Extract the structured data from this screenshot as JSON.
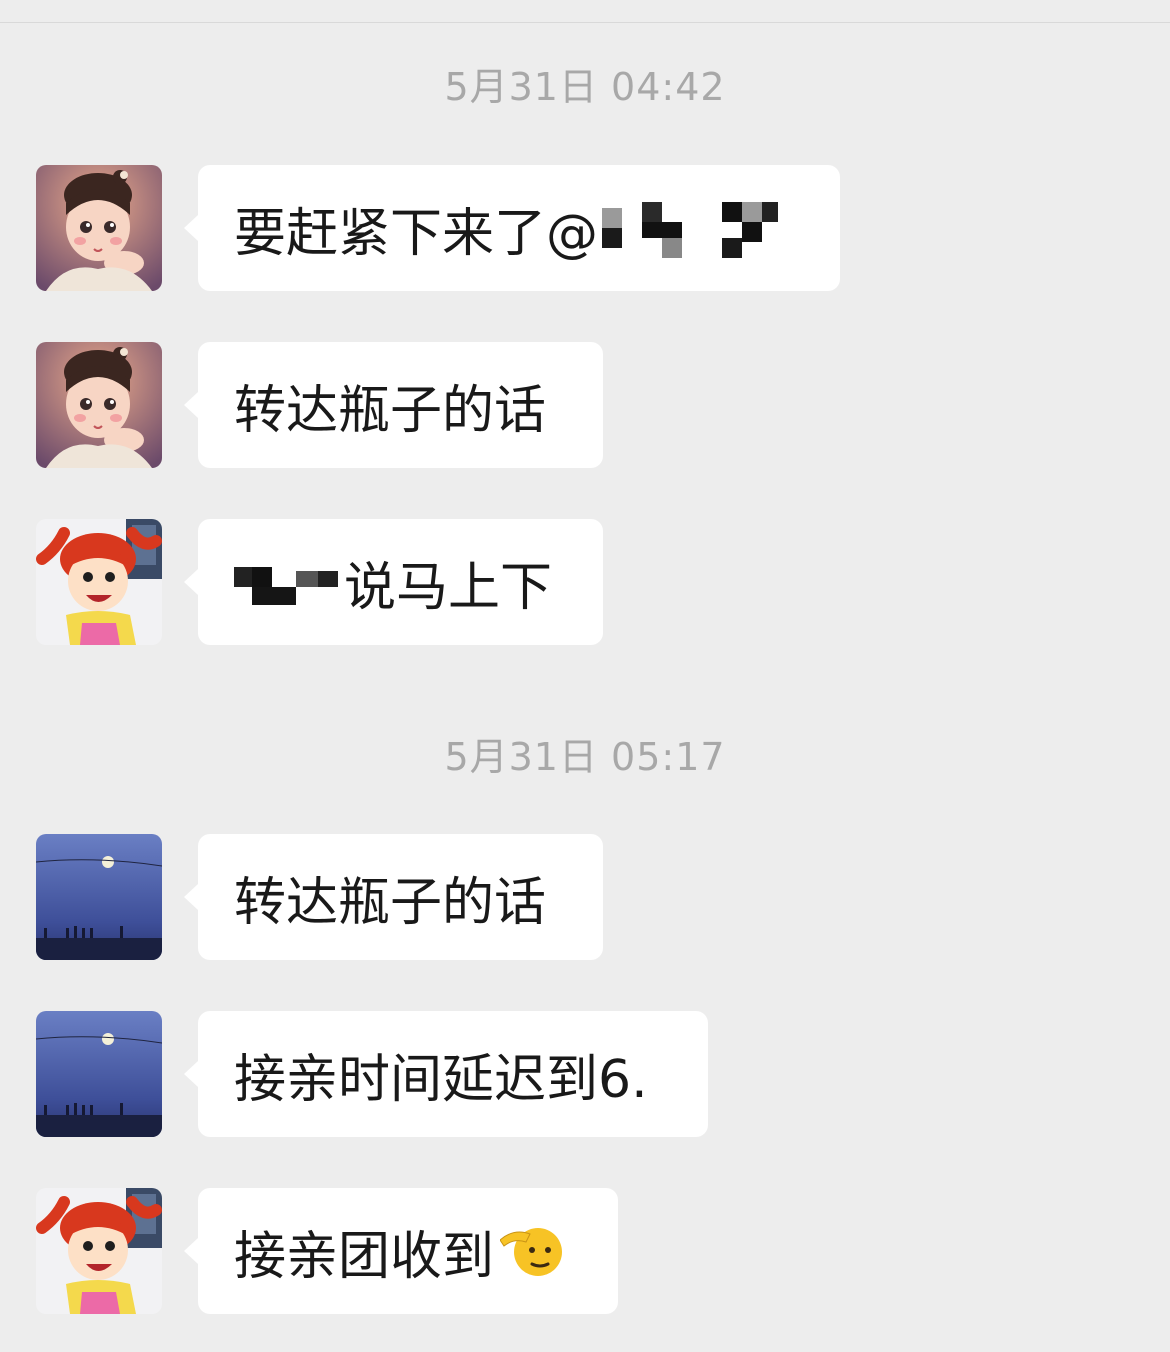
{
  "chat": {
    "timestamps": [
      "5月31日 04:42",
      "5月31日 05:17"
    ],
    "messages": [
      {
        "avatar": "girl-portrait-avatar",
        "text": "要赶紧下来了@",
        "extra": "pixelated-redaction"
      },
      {
        "avatar": "girl-portrait-avatar",
        "text": "转达瓶子的话"
      },
      {
        "avatar": "cartoon-redhead-avatar",
        "text": "说马上下",
        "extra": "pixelated-redaction"
      },
      {
        "avatar": "night-sky-avatar",
        "text": "转达瓶子的话"
      },
      {
        "avatar": "night-sky-avatar",
        "text": "接亲时间延迟到6."
      },
      {
        "avatar": "cartoon-redhead-avatar",
        "text": "接亲团收到",
        "extra": "saluting-face-emoji"
      }
    ]
  },
  "colors": {
    "background": "#ededed",
    "bubble": "#ffffff",
    "timestamp_text": "#a8a8a8",
    "message_text": "#191919"
  }
}
